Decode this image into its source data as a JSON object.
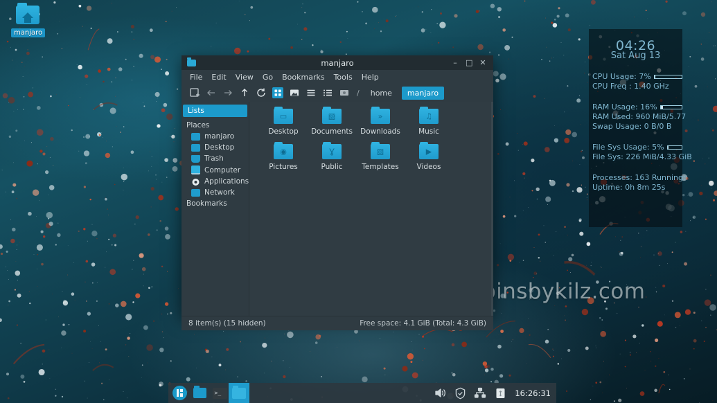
{
  "desktop": {
    "icon": {
      "label": "manjaro",
      "icon": "home-folder-icon"
    },
    "watermark": "Spinsbykilz.com"
  },
  "conky": {
    "time": "04:26",
    "date": "Sat Aug 13",
    "cpu_usage": "CPU Usage: 7%",
    "cpu_usage_pct": 7,
    "cpu_freq": "CPU Freq : 1.40 GHz",
    "ram_usage": "RAM Usage: 16%",
    "ram_usage_pct": 16,
    "ram_used": "RAM Used: 960 MiB/5.77",
    "swap_usage": "Swap Usage: 0 B/0 B",
    "fs_usage": "File Sys Usage:  5%",
    "fs_usage_pct": 5,
    "fs_used": "File Sys: 226 MiB/4.33 GiB",
    "processes": "Processes: 163   Running:",
    "uptime": "Uptime: 0h 8m 25s"
  },
  "filemanager": {
    "title": "manjaro",
    "window_buttons": {
      "minimize": "–",
      "maximize": "□",
      "close": "✕"
    },
    "menu": [
      "File",
      "Edit",
      "View",
      "Go",
      "Bookmarks",
      "Tools",
      "Help"
    ],
    "toolbar_icons": [
      "new-tab-icon",
      "back-icon",
      "forward-icon",
      "up-icon",
      "reload-icon",
      "icon-view-icon",
      "thumbnail-view-icon",
      "detailed-list-view-icon",
      "compact-list-view-icon",
      "location-icon"
    ],
    "breadcrumbs": [
      {
        "label": "/",
        "current": false
      },
      {
        "label": "home",
        "current": false
      },
      {
        "label": "manjaro",
        "current": true
      }
    ],
    "sidebar": {
      "header": "Lists",
      "places_label": "Places",
      "places": [
        {
          "label": "manjaro",
          "icon": "home-folder-icon"
        },
        {
          "label": "Desktop",
          "icon": "desktop-folder-icon"
        },
        {
          "label": "Trash",
          "icon": "trash-icon"
        },
        {
          "label": "Computer",
          "icon": "computer-icon"
        },
        {
          "label": "Applications",
          "icon": "applications-gear-icon"
        },
        {
          "label": "Network",
          "icon": "network-folder-icon"
        }
      ],
      "bookmarks_label": "Bookmarks"
    },
    "items": [
      {
        "name": "Desktop",
        "mark": "▭",
        "icon": "desktop-folder-icon"
      },
      {
        "name": "Documents",
        "mark": "▧",
        "icon": "documents-folder-icon"
      },
      {
        "name": "Downloads",
        "mark": "»",
        "icon": "downloads-folder-icon"
      },
      {
        "name": "Music",
        "mark": "♫",
        "icon": "music-folder-icon"
      },
      {
        "name": "Pictures",
        "mark": "◉",
        "icon": "pictures-folder-icon"
      },
      {
        "name": "Public",
        "mark": "Ɣ",
        "icon": "public-folder-icon"
      },
      {
        "name": "Templates",
        "mark": "▧",
        "icon": "templates-folder-icon"
      },
      {
        "name": "Videos",
        "mark": "▶",
        "icon": "videos-folder-icon"
      }
    ],
    "status": {
      "left": "8 item(s) (15 hidden)",
      "right": "Free space: 4.1 GiB (Total: 4.3 GiB)"
    }
  },
  "panel": {
    "launchers": [
      {
        "name": "manjaro-menu-icon"
      },
      {
        "name": "file-manager-icon"
      },
      {
        "name": "terminal-icon"
      }
    ],
    "task_button": {
      "name": "manjaro-window-task",
      "icon": "folder-icon"
    },
    "tray": [
      {
        "name": "volume-icon",
        "glyph": "🔊"
      },
      {
        "name": "shield-icon",
        "glyph": "✓"
      },
      {
        "name": "network-icon",
        "glyph": "☴"
      },
      {
        "name": "usb-icon",
        "glyph": "⚲"
      }
    ],
    "clock": "16:26:31"
  },
  "colors": {
    "accent": "#1c9acb",
    "window_bg": "#2f3b42",
    "titlebar": "#222c31",
    "panel": "#2c3840",
    "conky_text": "#7fb6cf"
  }
}
